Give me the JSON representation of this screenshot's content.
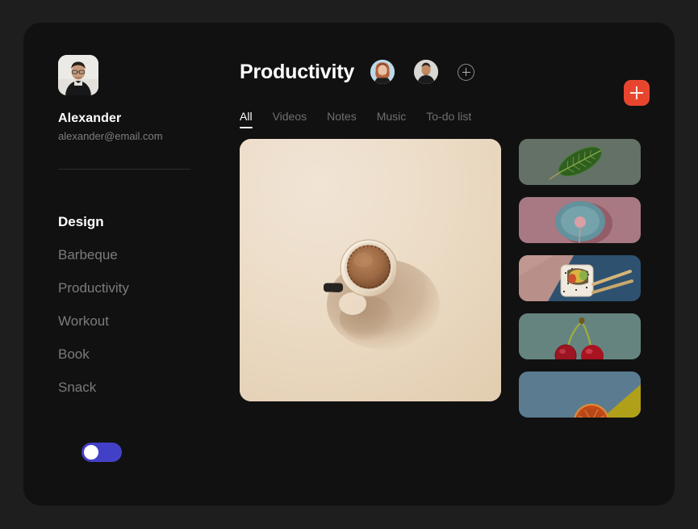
{
  "theme": {
    "page_background": "#1e1e1e",
    "card_background": "#111111",
    "accent_orange": "#e8452f",
    "accent_blue": "#4340c8",
    "text_primary": "#ffffff",
    "text_muted": "#7b7b7b"
  },
  "sidebar": {
    "profile": {
      "avatar_icon": "user-photo-avatar",
      "name": "Alexander",
      "email": "alexander@email.com"
    },
    "nav_items": [
      {
        "label": "Design",
        "active": true
      },
      {
        "label": "Barbeque",
        "active": false
      },
      {
        "label": "Productivity",
        "active": false
      },
      {
        "label": "Workout",
        "active": false
      },
      {
        "label": "Book",
        "active": false
      },
      {
        "label": "Snack",
        "active": false
      }
    ],
    "toggle": {
      "name": "theme-toggle",
      "state": "off",
      "track_color": "#4340c8",
      "knob_color": "#ffffff"
    }
  },
  "header": {
    "title": "Productivity",
    "members": [
      {
        "name": "member-avatar-1",
        "background": "#b9d7e6"
      },
      {
        "name": "member-avatar-2",
        "background": "#d8d6d3"
      }
    ],
    "add_member_icon": "plus-circle-icon",
    "add_button": {
      "icon": "plus-icon",
      "color": "#e8452f"
    }
  },
  "tabs": [
    {
      "label": "All",
      "active": true
    },
    {
      "label": "Videos",
      "active": false
    },
    {
      "label": "Notes",
      "active": false
    },
    {
      "label": "Music",
      "active": false
    },
    {
      "label": "To-do list",
      "active": false
    }
  ],
  "gallery": {
    "feature": {
      "name": "coffee-cup-photo",
      "description": "Top-down coffee cup on cream background",
      "background": "#ecdcc8"
    },
    "thumbnails": [
      {
        "name": "leaf-photo-thumbnail",
        "description": "Green leaf on sage background",
        "background": "#5c6b60"
      },
      {
        "name": "plate-photo-thumbnail",
        "description": "Blue plate on pink background",
        "background": "#a3737c"
      },
      {
        "name": "sushi-photo-thumbnail",
        "description": "Sushi roll with chopsticks",
        "background": "#2e4e68"
      },
      {
        "name": "cherries-photo-thumbnail",
        "description": "Two cherries on teal background",
        "background": "#5f7a74"
      },
      {
        "name": "citrus-photo-thumbnail",
        "description": "Citrus slice with yellow wedge",
        "background": "#5b7c93"
      }
    ]
  }
}
